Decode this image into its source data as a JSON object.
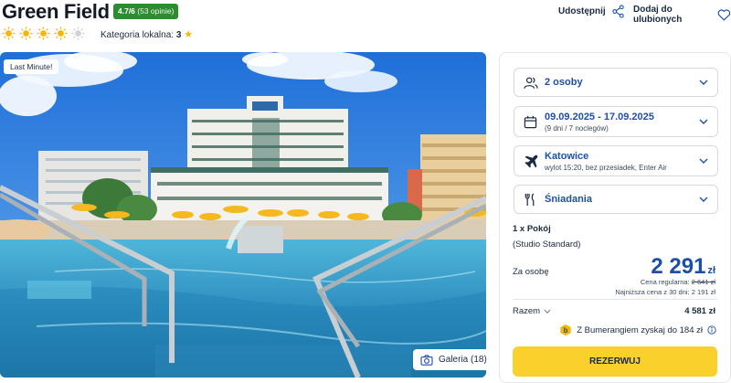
{
  "hotel": {
    "title": "Green Field",
    "rating_score": "4.7/6",
    "rating_count": "(53 opinie)",
    "suns_total": 5,
    "suns_filled": 4,
    "category_label": "Kategoria lokalna:",
    "category_value": "3"
  },
  "actions": {
    "share_label": "Udostępnij",
    "favorite_label": "Dodaj do ulubionych"
  },
  "photo": {
    "badge": "Last Minute!",
    "gallery_label": "Galeria (18)"
  },
  "booking": {
    "persons": "2 osoby",
    "dates": "09.09.2025 - 17.09.2025",
    "dates_sub": "(9 dni / 7 noclegów)",
    "departure": "Katowice",
    "departure_sub": "wylot 15:20, bez przesiadek, Enter Air",
    "board": "Śniadania",
    "room_line1": "1 x Pokój",
    "room_line2": "(Studio Standard)",
    "per_person_label": "Za osobę",
    "price": "2 291",
    "currency": "zł",
    "regular_label": "Cena regularna:",
    "regular_price": "2 641 zł",
    "lowest_label": "Najniższa cena z 30 dni:",
    "lowest_price": "2 191 zł",
    "total_label": "Razem",
    "total_value": "4 581 zł",
    "bumerang_text": "Z Bumerangiem zyskaj do 184 zł",
    "reserve_label": "REZERWUJ"
  },
  "colors": {
    "accent_blue": "#1d4fa8",
    "badge_green": "#2e8b2f",
    "button_yellow": "#fad02c",
    "sun_active": "#f5b800",
    "sun_inactive": "#cfd3d8"
  }
}
